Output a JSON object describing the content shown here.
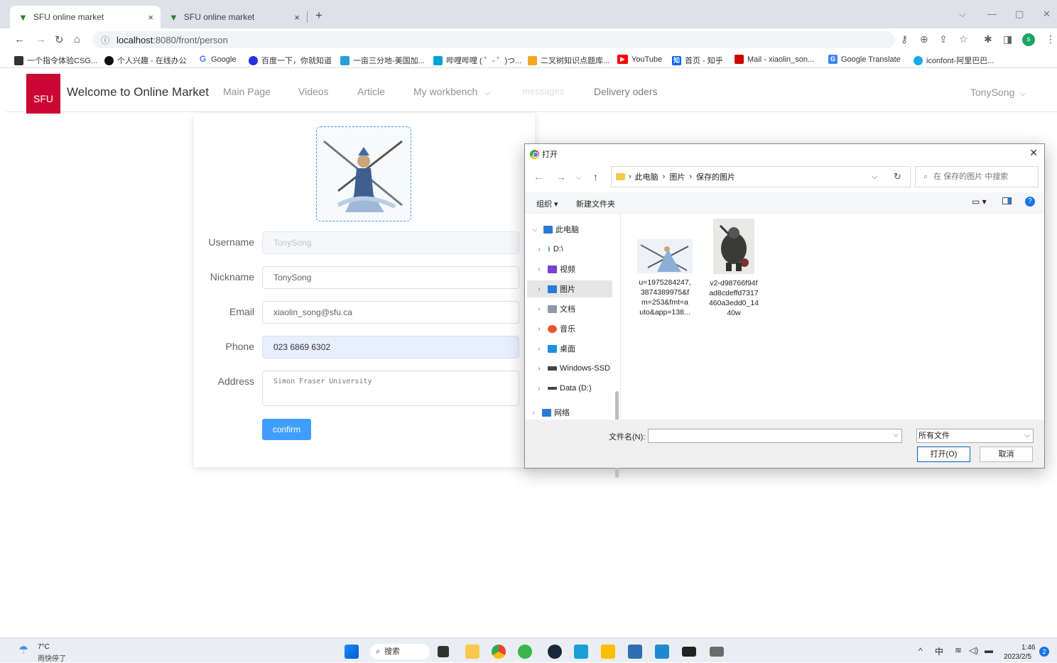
{
  "browser": {
    "tabs": [
      {
        "title": "SFU online market",
        "close": "×"
      },
      {
        "title": "SFU online market",
        "close": "×"
      }
    ],
    "new_tab": "+",
    "url_host": "localhost",
    "url_path": ":8080/front/person",
    "bookmarks": [
      {
        "label": "一个指令体验CSG...",
        "color": "#333"
      },
      {
        "label": "个人兴趣 - 在线办公",
        "color": "#111"
      },
      {
        "label": "Google",
        "color": "#4285f4"
      },
      {
        "label": "百度一下，你就知道",
        "color": "#2932e1"
      },
      {
        "label": "一亩三分地-美国加...",
        "color": "#2aa0d8"
      },
      {
        "label": "哔哩哔哩 ( ゜- ゜)つ...",
        "color": "#00a1d6"
      },
      {
        "label": "二叉树知识点题库...",
        "color": "#f5a623"
      },
      {
        "label": "YouTube",
        "color": "#ff0000"
      },
      {
        "label": "首页 - 知乎",
        "color": "#0066ff"
      },
      {
        "label": "Mail - xiaolin_son...",
        "color": "#c00"
      },
      {
        "label": "Google Translate",
        "color": "#4285f4"
      },
      {
        "label": "iconfont-阿里巴巴...",
        "color": "#1aabe5"
      }
    ],
    "profile_initial": "s"
  },
  "app": {
    "logo_text": "SFU",
    "title": "Welcome to Online Market",
    "menu": [
      "Main Page",
      "Videos",
      "Article",
      "My workbench",
      "messages",
      "Delivery oders"
    ],
    "user": "TonySong"
  },
  "form": {
    "username_label": "Username",
    "username_value": "TonySong",
    "nickname_label": "Nickname",
    "nickname_value": "TonySong",
    "email_label": "Email",
    "email_value": "xiaolin_song@sfu.ca",
    "phone_label": "Phone",
    "phone_value": "023 6869 6302",
    "address_label": "Address",
    "address_value": "Simon Fraser University",
    "confirm_label": "confirm"
  },
  "dialog": {
    "title": "打开",
    "path": [
      "此电脑",
      "图片",
      "保存的图片"
    ],
    "search_placeholder": "在 保存的图片 中搜索",
    "organize": "组织 ▾",
    "new_folder": "新建文件夹",
    "tree": [
      {
        "label": "此电脑",
        "icon_color": "#2b7bd6"
      },
      {
        "label": "D:\\",
        "icon_color": "#2b7bd6"
      },
      {
        "label": "视频",
        "icon_color": "#7c3fd1"
      },
      {
        "label": "图片",
        "icon_color": "#2b7bd6"
      },
      {
        "label": "文档",
        "icon_color": "#8e9aa6"
      },
      {
        "label": "音乐",
        "icon_color": "#e8562a"
      },
      {
        "label": "桌面",
        "icon_color": "#1e90e0"
      },
      {
        "label": "Windows-SSD",
        "icon_color": "#444"
      },
      {
        "label": "Data (D:)",
        "icon_color": "#444"
      },
      {
        "label": "网络",
        "icon_color": "#2b7bd6"
      }
    ],
    "files": [
      {
        "name_lines": [
          "u=1975284247,",
          "3874389975&f",
          "m=253&fmt=a",
          "uto&app=138..."
        ]
      },
      {
        "name_lines": [
          "v2-d98766f94f",
          "ad8cdeffd7317",
          "460a3edd0_14",
          "40w"
        ]
      }
    ],
    "filename_label": "文件名(N):",
    "filetype": "所有文件",
    "open_button": "打开(O)",
    "cancel_button": "取消"
  },
  "taskbar": {
    "weather_temp": "7°C",
    "weather_desc": "雨快停了",
    "search_label": "搜索",
    "ime": "中",
    "time": "1:46",
    "date": "2023/2/5",
    "notification_count": "2"
  }
}
